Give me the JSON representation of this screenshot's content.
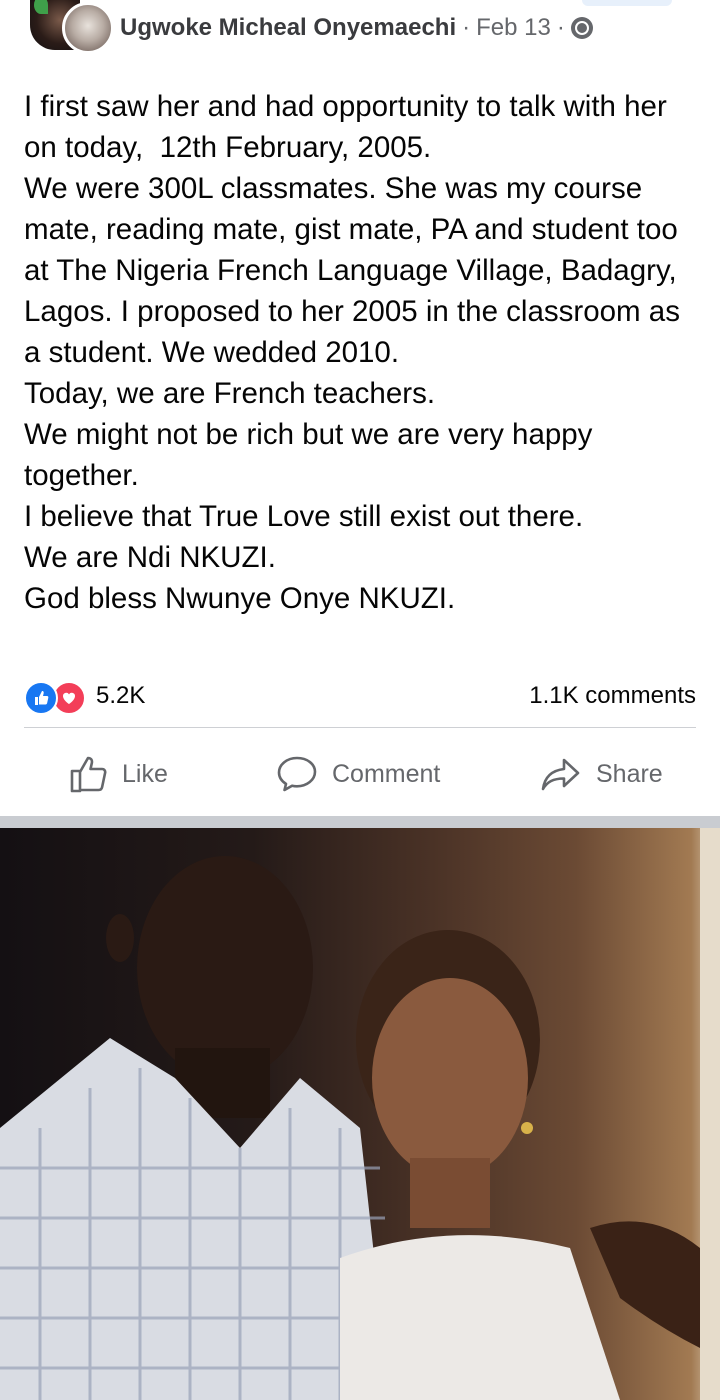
{
  "post": {
    "author": "Ugwoke Micheal Onyemaechi",
    "separator": "·",
    "date": "Feb 13",
    "separator2": "·",
    "privacy_icon": "globe-icon",
    "lines": [
      "I first saw her and had opportunity to talk with her on today,  12th February, 2005.",
      "We were 300L classmates. She was my course mate, reading mate, gist mate, PA and student too at The Nigeria French Language Village, Badagry, Lagos. I proposed to her 2005 in the classroom as a student. We wedded 2010.",
      "Today, we are French teachers.",
      "We might not be rich but we are very happy together.",
      "I believe that True Love still exist out there.",
      "We are Ndi NKUZI.",
      "God bless Nwunye Onye NKUZI."
    ]
  },
  "stats": {
    "reaction_count": "5.2K",
    "comments": "1.1K comments",
    "reaction_icons": [
      "like-icon",
      "love-icon"
    ]
  },
  "actions": {
    "like": "Like",
    "comment": "Comment",
    "share": "Share"
  },
  "colors": {
    "accent": "#1877f2",
    "love": "#f33e58",
    "muted": "#65676b"
  }
}
